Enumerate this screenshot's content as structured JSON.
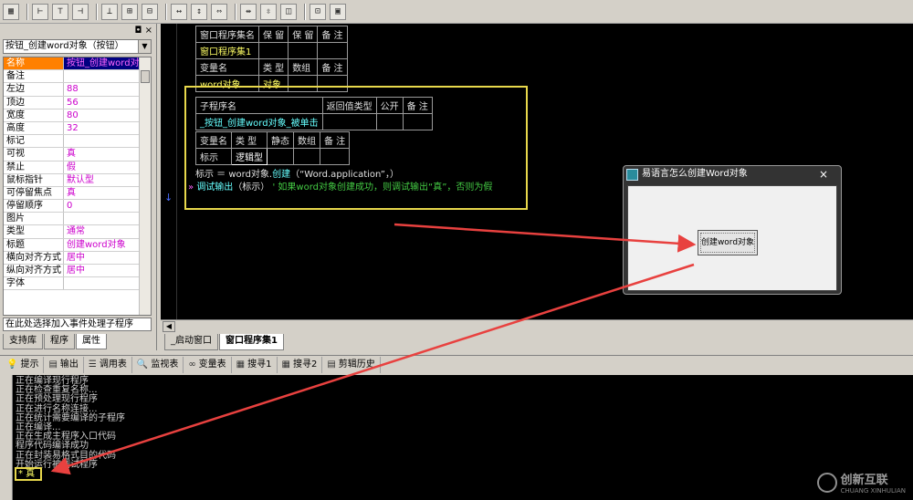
{
  "toolbar": {
    "buttons": [
      "grid-icon",
      "align-left-icon",
      "align-center-icon",
      "align-right-icon",
      "align-top-icon",
      "align-middle-icon",
      "align-bottom-icon",
      "same-width-icon",
      "same-height-icon",
      "same-size-icon",
      "h-space-icon",
      "v-space-icon",
      "center-h-icon",
      "center-v-icon",
      "front-icon"
    ]
  },
  "property_panel": {
    "object_combo": "按钮_创建word对象（按钮）",
    "rows": [
      {
        "k": "名称",
        "v": "按钮_创建word对象"
      },
      {
        "k": "备注",
        "v": ""
      },
      {
        "k": "左边",
        "v": "88"
      },
      {
        "k": "顶边",
        "v": "56"
      },
      {
        "k": "宽度",
        "v": "80"
      },
      {
        "k": "高度",
        "v": "32"
      },
      {
        "k": "标记",
        "v": ""
      },
      {
        "k": "可视",
        "v": "真"
      },
      {
        "k": "禁止",
        "v": "假"
      },
      {
        "k": "鼠标指针",
        "v": "默认型"
      },
      {
        "k": "可停留焦点",
        "v": "真"
      },
      {
        "k": "停留顺序",
        "v": "0"
      },
      {
        "k": "图片",
        "v": ""
      },
      {
        "k": "类型",
        "v": "通常"
      },
      {
        "k": "标题",
        "v": "创建word对象"
      },
      {
        "k": "横向对齐方式",
        "v": "居中"
      },
      {
        "k": "纵向对齐方式",
        "v": "居中"
      },
      {
        "k": "字体",
        "v": ""
      }
    ],
    "event_combo": "在此处选择加入事件处理子程序",
    "tabs": [
      "支持库",
      "程序",
      "属性"
    ]
  },
  "editor": {
    "table1": [
      [
        "窗口程序集名",
        "保 留",
        "保 留",
        "备 注"
      ],
      [
        "窗口程序集1",
        "",
        "",
        ""
      ],
      [
        "变量名",
        "类 型",
        "数组",
        "备 注"
      ],
      [
        "word对象",
        "对象",
        "",
        ""
      ]
    ],
    "sub_table": [
      [
        "子程序名",
        "返回值类型",
        "公开",
        "备 注"
      ],
      [
        "_按钮_创建word对象_被单击",
        "",
        "",
        ""
      ]
    ],
    "var_table": [
      [
        "变量名",
        "类 型",
        "静态",
        "数组",
        "备 注"
      ],
      [
        "标示",
        "逻辑型",
        "",
        "",
        ""
      ]
    ],
    "line1_a": "标示 ＝ word对象.",
    "line1_b": "创建",
    "line1_c": "（“Word.application”，）",
    "line2_a": "调试输出",
    "line2_b": "（标示）",
    "line2_c": "' 如果word对象创建成功，则调试输出“真”，否则为假",
    "tabs": [
      "_启动窗口",
      "窗口程序集1"
    ]
  },
  "popup": {
    "title": "易语言怎么创建Word对象",
    "close": "×",
    "button": "创建word对象"
  },
  "output_tabs": [
    {
      "icon": "tip-icon",
      "glyph": "💡",
      "label": "提示"
    },
    {
      "icon": "output-icon",
      "glyph": "▤",
      "label": "输出"
    },
    {
      "icon": "call-table-icon",
      "glyph": "☰",
      "label": "调用表"
    },
    {
      "icon": "watch-icon",
      "glyph": "🔍",
      "label": "监视表"
    },
    {
      "icon": "variable-icon",
      "glyph": "∞",
      "label": "变量表"
    },
    {
      "icon": "search1-icon",
      "glyph": "▦",
      "label": "搜寻1"
    },
    {
      "icon": "search2-icon",
      "glyph": "▦",
      "label": "搜寻2"
    },
    {
      "icon": "clip-history-icon",
      "glyph": "▤",
      "label": "剪辑历史"
    }
  ],
  "output_lines": [
    "正在编译现行程序",
    "正在检查重复名称...",
    "正在预处理现行程序",
    "正在进行名称连接...",
    "正在统计需要编译的子程序",
    "正在编译...",
    "正在生成主程序入口代码",
    "程序代码编译成功",
    "正在封装易格式目的代码",
    "开始运行被调试程序"
  ],
  "output_result": "* 真",
  "watermark": {
    "text": "创新互联",
    "sub": "CHUANG XINHULIAN"
  },
  "colors": {
    "accent_highlight": "#e8d84c",
    "arrow": "#e8413f"
  }
}
